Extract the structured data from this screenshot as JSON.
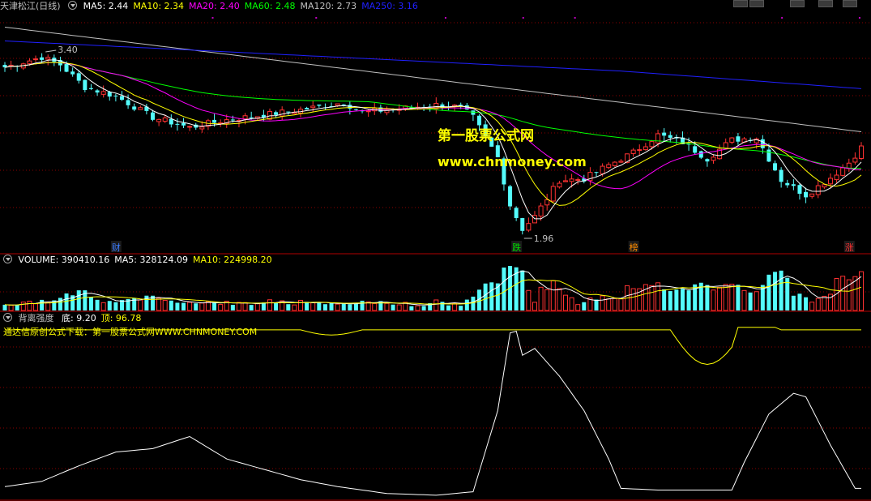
{
  "colors": {
    "up": "#ff3232",
    "down": "#54fcfc",
    "ma5": "#ffffff",
    "ma10": "#ffff00",
    "ma20": "#ff00ff",
    "ma60": "#00ff00",
    "ma120": "#c0c0c0",
    "ma250": "#2020ff",
    "grid": "#8b0000",
    "panel_border": "#b00000",
    "indicator_title": "#ffff00"
  },
  "main_panel": {
    "stock_name": "天津松江",
    "period": "(日线)",
    "ma_labels": [
      {
        "key": "ma5",
        "label": "MA5: 2.44"
      },
      {
        "key": "ma10",
        "label": "MA10: 2.34"
      },
      {
        "key": "ma20",
        "label": "MA20: 2.40"
      },
      {
        "key": "ma60",
        "label": "MA60: 2.48"
      },
      {
        "key": "ma120",
        "label": "MA120: 2.73"
      },
      {
        "key": "ma250",
        "label": "MA250: 3.16"
      }
    ],
    "high_label": "3.40",
    "low_label": "1.96",
    "event_markers": [
      {
        "text": "财",
        "color": "#3c7cff"
      },
      {
        "text": "跌",
        "color": "#00e000"
      },
      {
        "text": "榜",
        "color": "#ff8c00"
      },
      {
        "text": "涨",
        "color": "#ff3030"
      }
    ]
  },
  "watermark": {
    "line1": "第一股票公式网",
    "line2": "www.chnmoney.com"
  },
  "volume_panel": {
    "labels": [
      {
        "key": "ma5",
        "label": "VOLUME: 390410.16"
      },
      {
        "key": "ma5",
        "label": "MA5: 328124.09"
      },
      {
        "key": "ma10",
        "label": "MA10: 224998.20"
      }
    ]
  },
  "indicator_panel": {
    "name": "背离强度",
    "labels": [
      {
        "key": "ma5",
        "label": "底: 9.20"
      },
      {
        "key": "ma10",
        "label": "顶: 96.78"
      }
    ],
    "note": "通达信原创公式下载：第一股票公式网WWW.CHNMONEY.COM"
  },
  "chart_data": [
    {
      "type": "candlestick",
      "title": "天津松江 (日线)",
      "ylim": [
        1.8,
        3.7
      ],
      "x_count": 140,
      "annotations": [
        "3.40",
        "1.96"
      ],
      "series": [
        {
          "name": "MA5",
          "values": [
            2.44
          ]
        },
        {
          "name": "MA10",
          "values": [
            2.34
          ]
        },
        {
          "name": "MA20",
          "values": [
            2.4
          ]
        },
        {
          "name": "MA60",
          "values": [
            2.48
          ]
        },
        {
          "name": "MA120",
          "values": [
            2.73
          ]
        },
        {
          "name": "MA250",
          "values": [
            3.16
          ]
        }
      ],
      "closes_keypoints": [
        [
          0,
          3.28
        ],
        [
          6,
          3.36
        ],
        [
          9,
          3.3
        ],
        [
          13,
          3.12
        ],
        [
          18,
          3.05
        ],
        [
          24,
          2.88
        ],
        [
          30,
          2.8
        ],
        [
          36,
          2.86
        ],
        [
          42,
          2.9
        ],
        [
          48,
          2.94
        ],
        [
          55,
          3.0
        ],
        [
          58,
          2.92
        ],
        [
          62,
          2.94
        ],
        [
          66,
          2.96
        ],
        [
          70,
          2.98
        ],
        [
          74,
          2.96
        ],
        [
          76,
          2.88
        ],
        [
          80,
          2.56
        ],
        [
          82,
          2.18
        ],
        [
          84,
          1.99
        ],
        [
          86,
          2.09
        ],
        [
          90,
          2.38
        ],
        [
          94,
          2.39
        ],
        [
          98,
          2.5
        ],
        [
          102,
          2.6
        ],
        [
          106,
          2.74
        ],
        [
          110,
          2.68
        ],
        [
          114,
          2.55
        ],
        [
          118,
          2.7
        ],
        [
          122,
          2.72
        ],
        [
          126,
          2.38
        ],
        [
          130,
          2.26
        ],
        [
          134,
          2.4
        ],
        [
          137,
          2.52
        ],
        [
          139,
          2.64
        ]
      ]
    },
    {
      "type": "bar",
      "title": "VOLUME",
      "series": [
        {
          "name": "VOLUME",
          "values": [
            390410.16
          ]
        },
        {
          "name": "MA5",
          "values": [
            328124.09
          ]
        },
        {
          "name": "MA10",
          "values": [
            224998.2
          ]
        }
      ]
    },
    {
      "type": "line",
      "title": "背离强度",
      "ylim": [
        0,
        100
      ],
      "series": [
        {
          "name": "顶",
          "values": [
            96.78
          ]
        },
        {
          "name": "底",
          "values": [
            9.2
          ]
        },
        {
          "name": "strength_keypoints",
          "values": [
            [
              0,
              6
            ],
            [
              6,
              9
            ],
            [
              12,
              18
            ],
            [
              18,
              26
            ],
            [
              24,
              28
            ],
            [
              30,
              35
            ],
            [
              36,
              22
            ],
            [
              42,
              16
            ],
            [
              48,
              10
            ],
            [
              54,
              6
            ],
            [
              62,
              2
            ],
            [
              70,
              1
            ],
            [
              76,
              3
            ],
            [
              80,
              50
            ],
            [
              82,
              95
            ],
            [
              83,
              96
            ],
            [
              84,
              82
            ],
            [
              86,
              86
            ],
            [
              90,
              70
            ],
            [
              94,
              50
            ],
            [
              98,
              22
            ],
            [
              100,
              5
            ],
            [
              106,
              4
            ],
            [
              112,
              4
            ],
            [
              118,
              4
            ],
            [
              120,
              20
            ],
            [
              124,
              48
            ],
            [
              128,
              60
            ],
            [
              130,
              58
            ],
            [
              134,
              30
            ],
            [
              138,
              5
            ]
          ]
        }
      ]
    }
  ]
}
